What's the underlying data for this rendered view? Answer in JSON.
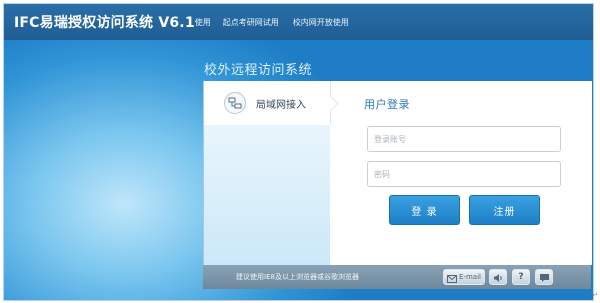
{
  "app": {
    "title": "IFC易瑞授权访问系统 V6.1"
  },
  "nav": {
    "items": [
      {
        "label": "使用"
      },
      {
        "label": "起点考研网试用"
      },
      {
        "label": "校内网开放使用"
      }
    ]
  },
  "portal": {
    "title": "校外远程访问系统"
  },
  "tabs": {
    "lan": {
      "label": "局域网接入",
      "icon": "lan-network-icon"
    }
  },
  "login": {
    "title": "用户登录",
    "account_placeholder": "登录账号",
    "password_placeholder": "密码",
    "login_label": "登 录",
    "register_label": "注册"
  },
  "footer": {
    "note": "建议使用IE8及以上浏览器或谷歌浏览器",
    "email_label": "E-mail",
    "icons": [
      "email-icon",
      "speaker-icon",
      "help-icon",
      "chat-icon"
    ]
  },
  "colors": {
    "topbar": "#1f5d94",
    "accent": "#2a78c2",
    "button": "#1d80c8",
    "footer": "#6d889d"
  }
}
